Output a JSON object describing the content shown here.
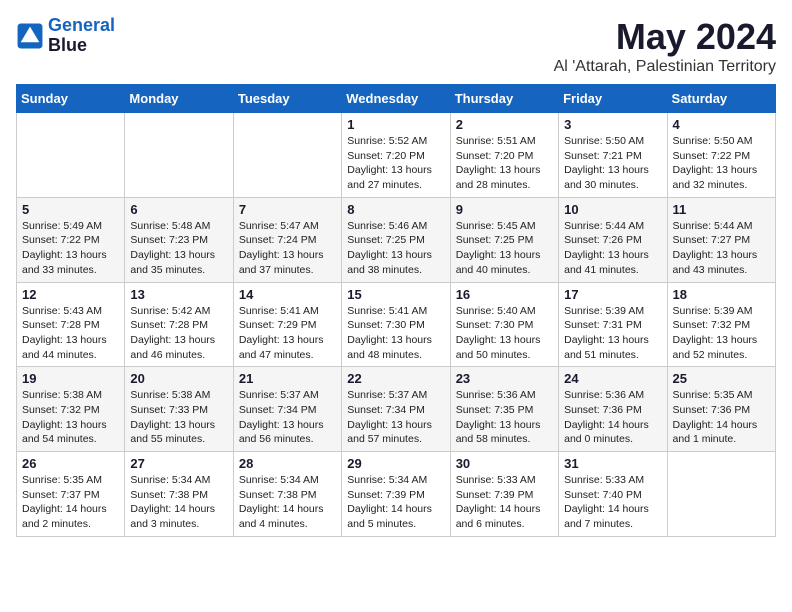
{
  "header": {
    "logo_line1": "General",
    "logo_line2": "Blue",
    "month": "May 2024",
    "location": "Al 'Attarah, Palestinian Territory"
  },
  "weekdays": [
    "Sunday",
    "Monday",
    "Tuesday",
    "Wednesday",
    "Thursday",
    "Friday",
    "Saturday"
  ],
  "weeks": [
    [
      {
        "day": "",
        "info": ""
      },
      {
        "day": "",
        "info": ""
      },
      {
        "day": "",
        "info": ""
      },
      {
        "day": "1",
        "info": "Sunrise: 5:52 AM\nSunset: 7:20 PM\nDaylight: 13 hours\nand 27 minutes."
      },
      {
        "day": "2",
        "info": "Sunrise: 5:51 AM\nSunset: 7:20 PM\nDaylight: 13 hours\nand 28 minutes."
      },
      {
        "day": "3",
        "info": "Sunrise: 5:50 AM\nSunset: 7:21 PM\nDaylight: 13 hours\nand 30 minutes."
      },
      {
        "day": "4",
        "info": "Sunrise: 5:50 AM\nSunset: 7:22 PM\nDaylight: 13 hours\nand 32 minutes."
      }
    ],
    [
      {
        "day": "5",
        "info": "Sunrise: 5:49 AM\nSunset: 7:22 PM\nDaylight: 13 hours\nand 33 minutes."
      },
      {
        "day": "6",
        "info": "Sunrise: 5:48 AM\nSunset: 7:23 PM\nDaylight: 13 hours\nand 35 minutes."
      },
      {
        "day": "7",
        "info": "Sunrise: 5:47 AM\nSunset: 7:24 PM\nDaylight: 13 hours\nand 37 minutes."
      },
      {
        "day": "8",
        "info": "Sunrise: 5:46 AM\nSunset: 7:25 PM\nDaylight: 13 hours\nand 38 minutes."
      },
      {
        "day": "9",
        "info": "Sunrise: 5:45 AM\nSunset: 7:25 PM\nDaylight: 13 hours\nand 40 minutes."
      },
      {
        "day": "10",
        "info": "Sunrise: 5:44 AM\nSunset: 7:26 PM\nDaylight: 13 hours\nand 41 minutes."
      },
      {
        "day": "11",
        "info": "Sunrise: 5:44 AM\nSunset: 7:27 PM\nDaylight: 13 hours\nand 43 minutes."
      }
    ],
    [
      {
        "day": "12",
        "info": "Sunrise: 5:43 AM\nSunset: 7:28 PM\nDaylight: 13 hours\nand 44 minutes."
      },
      {
        "day": "13",
        "info": "Sunrise: 5:42 AM\nSunset: 7:28 PM\nDaylight: 13 hours\nand 46 minutes."
      },
      {
        "day": "14",
        "info": "Sunrise: 5:41 AM\nSunset: 7:29 PM\nDaylight: 13 hours\nand 47 minutes."
      },
      {
        "day": "15",
        "info": "Sunrise: 5:41 AM\nSunset: 7:30 PM\nDaylight: 13 hours\nand 48 minutes."
      },
      {
        "day": "16",
        "info": "Sunrise: 5:40 AM\nSunset: 7:30 PM\nDaylight: 13 hours\nand 50 minutes."
      },
      {
        "day": "17",
        "info": "Sunrise: 5:39 AM\nSunset: 7:31 PM\nDaylight: 13 hours\nand 51 minutes."
      },
      {
        "day": "18",
        "info": "Sunrise: 5:39 AM\nSunset: 7:32 PM\nDaylight: 13 hours\nand 52 minutes."
      }
    ],
    [
      {
        "day": "19",
        "info": "Sunrise: 5:38 AM\nSunset: 7:32 PM\nDaylight: 13 hours\nand 54 minutes."
      },
      {
        "day": "20",
        "info": "Sunrise: 5:38 AM\nSunset: 7:33 PM\nDaylight: 13 hours\nand 55 minutes."
      },
      {
        "day": "21",
        "info": "Sunrise: 5:37 AM\nSunset: 7:34 PM\nDaylight: 13 hours\nand 56 minutes."
      },
      {
        "day": "22",
        "info": "Sunrise: 5:37 AM\nSunset: 7:34 PM\nDaylight: 13 hours\nand 57 minutes."
      },
      {
        "day": "23",
        "info": "Sunrise: 5:36 AM\nSunset: 7:35 PM\nDaylight: 13 hours\nand 58 minutes."
      },
      {
        "day": "24",
        "info": "Sunrise: 5:36 AM\nSunset: 7:36 PM\nDaylight: 14 hours\nand 0 minutes."
      },
      {
        "day": "25",
        "info": "Sunrise: 5:35 AM\nSunset: 7:36 PM\nDaylight: 14 hours\nand 1 minute."
      }
    ],
    [
      {
        "day": "26",
        "info": "Sunrise: 5:35 AM\nSunset: 7:37 PM\nDaylight: 14 hours\nand 2 minutes."
      },
      {
        "day": "27",
        "info": "Sunrise: 5:34 AM\nSunset: 7:38 PM\nDaylight: 14 hours\nand 3 minutes."
      },
      {
        "day": "28",
        "info": "Sunrise: 5:34 AM\nSunset: 7:38 PM\nDaylight: 14 hours\nand 4 minutes."
      },
      {
        "day": "29",
        "info": "Sunrise: 5:34 AM\nSunset: 7:39 PM\nDaylight: 14 hours\nand 5 minutes."
      },
      {
        "day": "30",
        "info": "Sunrise: 5:33 AM\nSunset: 7:39 PM\nDaylight: 14 hours\nand 6 minutes."
      },
      {
        "day": "31",
        "info": "Sunrise: 5:33 AM\nSunset: 7:40 PM\nDaylight: 14 hours\nand 7 minutes."
      },
      {
        "day": "",
        "info": ""
      }
    ]
  ]
}
